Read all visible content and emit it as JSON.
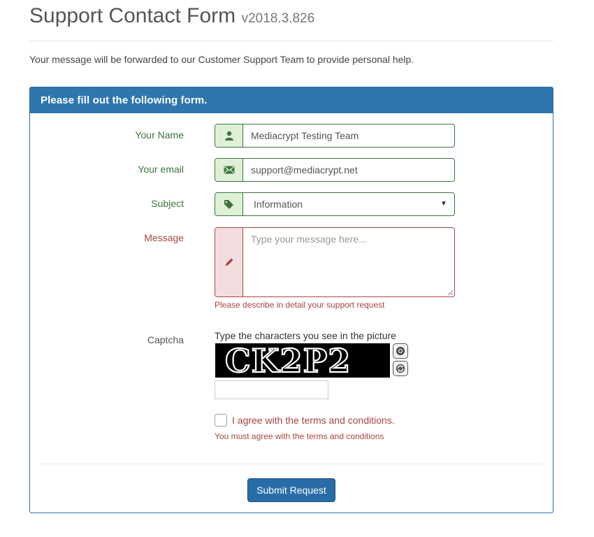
{
  "header": {
    "title": "Support Contact Form",
    "version": "v2018.3.826",
    "intro": "Your message will be forwarded to our Customer Support Team to provide personal help."
  },
  "panel": {
    "heading": "Please fill out the following form."
  },
  "form": {
    "name": {
      "label": "Your Name",
      "value": "Mediacrypt Testing Team",
      "icon": "user-icon"
    },
    "email": {
      "label": "Your email",
      "value": "support@mediacrypt.net",
      "icon": "envelope-icon"
    },
    "subject": {
      "label": "Subject",
      "value": "Information",
      "icon": "tag-icon"
    },
    "message": {
      "label": "Message",
      "placeholder": "Type your message here...",
      "error": "Please describe in detail your support request",
      "icon": "pencil-icon"
    },
    "captcha": {
      "label": "Captcha",
      "hint": "Type the characters you see in the picture",
      "image_text": "CK2P2",
      "audio_icon": "audio-icon",
      "refresh_icon": "refresh-icon"
    },
    "terms": {
      "label": "I agree with the terms and conditions.",
      "error": "You must agree with the terms and conditions",
      "checked": false
    },
    "submit_label": "Submit Request"
  },
  "colors": {
    "primary": "#2e76ad",
    "success": "#3c763d",
    "success_bg": "#dff0d8",
    "error": "#a94442",
    "error_bg": "#f2dede"
  }
}
